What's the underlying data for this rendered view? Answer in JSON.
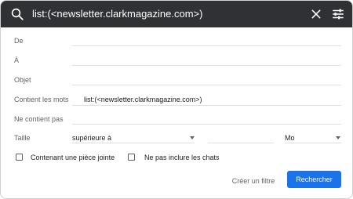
{
  "search": {
    "query": "list:(<newsletter.clarkmagazine.com>)"
  },
  "form": {
    "from_label": "De",
    "to_label": "À",
    "subject_label": "Objet",
    "has_words_label": "Contient les mots",
    "has_words_value": "list:(<newsletter.clarkmagazine.com>)",
    "doesnt_have_label": "Ne contient pas",
    "size_label": "Taille",
    "size_operator": "supérieure à",
    "size_unit": "Mo",
    "has_attachment_label": "Contenant une pièce jointe",
    "exclude_chats_label": "Ne pas inclure les chats"
  },
  "actions": {
    "create_filter": "Créer un filtre",
    "search": "Rechercher"
  }
}
